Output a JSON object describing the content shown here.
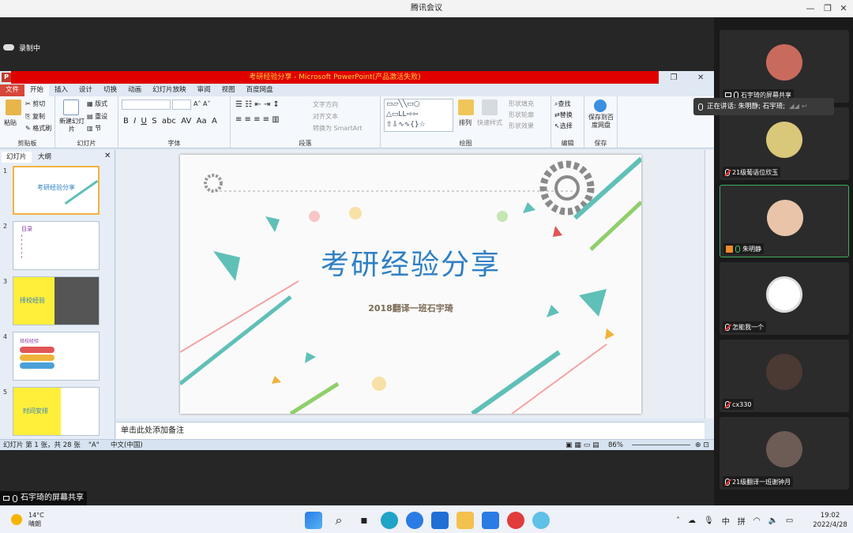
{
  "window": {
    "title": "腾讯会议",
    "minimize": "—",
    "restore": "❐",
    "close": "✕"
  },
  "recording": {
    "label": "录制中"
  },
  "ppt": {
    "title": "考研经验分享 - Microsoft PowerPoint(产品激活失败)",
    "tabs": [
      "文件",
      "开始",
      "插入",
      "设计",
      "切换",
      "动画",
      "幻灯片放映",
      "审阅",
      "视图",
      "百度网盘"
    ],
    "groups": {
      "clipboard": {
        "label": "剪贴板",
        "paste": "粘贴",
        "cut": "剪切",
        "copy": "复制",
        "format_painter": "格式刷"
      },
      "slides": {
        "label": "幻灯片",
        "new_slide": "新建幻灯片",
        "layout": "版式",
        "reset": "重设",
        "section": "节"
      },
      "font": {
        "label": "字体"
      },
      "paragraph": {
        "label": "段落",
        "text_direction": "文字方向",
        "align_text": "对齐文本",
        "smartart": "转换为 SmartArt"
      },
      "drawing": {
        "label": "绘图",
        "arrange": "排列",
        "quick_styles": "快速样式",
        "shape_fill": "形状填充",
        "shape_outline": "形状轮廓",
        "shape_effects": "形状效果"
      },
      "editing": {
        "label": "编辑",
        "find": "查找",
        "replace": "替换",
        "select": "选择"
      },
      "save": {
        "label": "保存",
        "save_baidu": "保存到百度网盘"
      }
    },
    "pane_tabs": [
      "幻灯片",
      "大纲"
    ],
    "thumbs": [
      {
        "num": "1",
        "text": "考研经验分享"
      },
      {
        "num": "2",
        "text": "目录"
      },
      {
        "num": "3",
        "text": "择校经验"
      },
      {
        "num": "4",
        "text": "择校经验"
      },
      {
        "num": "5",
        "text": "时间安排"
      }
    ],
    "slide": {
      "title": "考研经验分享",
      "subtitle": "2018翻译一班石宇琦"
    },
    "notes_placeholder": "单击此处添加备注",
    "status": {
      "slide_info": "幻灯片 第 1 张，共 28 张",
      "theme": "\"A\"",
      "language": "中文(中国)",
      "zoom": "86%"
    }
  },
  "speaking": {
    "text": "正在讲话: 朱明静; 石宇琦;"
  },
  "share_label": "石宇琦的屏幕共享",
  "participants": [
    {
      "name": "石宇琦的屏幕共享",
      "avatar_color": "#c96b5c",
      "muted": false
    },
    {
      "name": "21级葡语位欣玉",
      "avatar_color": "#d9c77a",
      "muted": true
    },
    {
      "name": "朱明静",
      "avatar_color": "#e9c4a8",
      "muted": false
    },
    {
      "name": "怎能我一个",
      "avatar_color": "#bbbbbb",
      "muted": true
    },
    {
      "name": "cx330",
      "avatar_color": "#4a3a33",
      "muted": true
    },
    {
      "name": "21级翻译一班谢钟月",
      "avatar_color": "#6d5b55",
      "muted": true
    }
  ],
  "taskbar": {
    "weather_temp": "14°C",
    "weather_desc": "晴朗",
    "ime1": "中",
    "ime2": "拼",
    "time": "19:02",
    "date": "2022/4/28"
  }
}
